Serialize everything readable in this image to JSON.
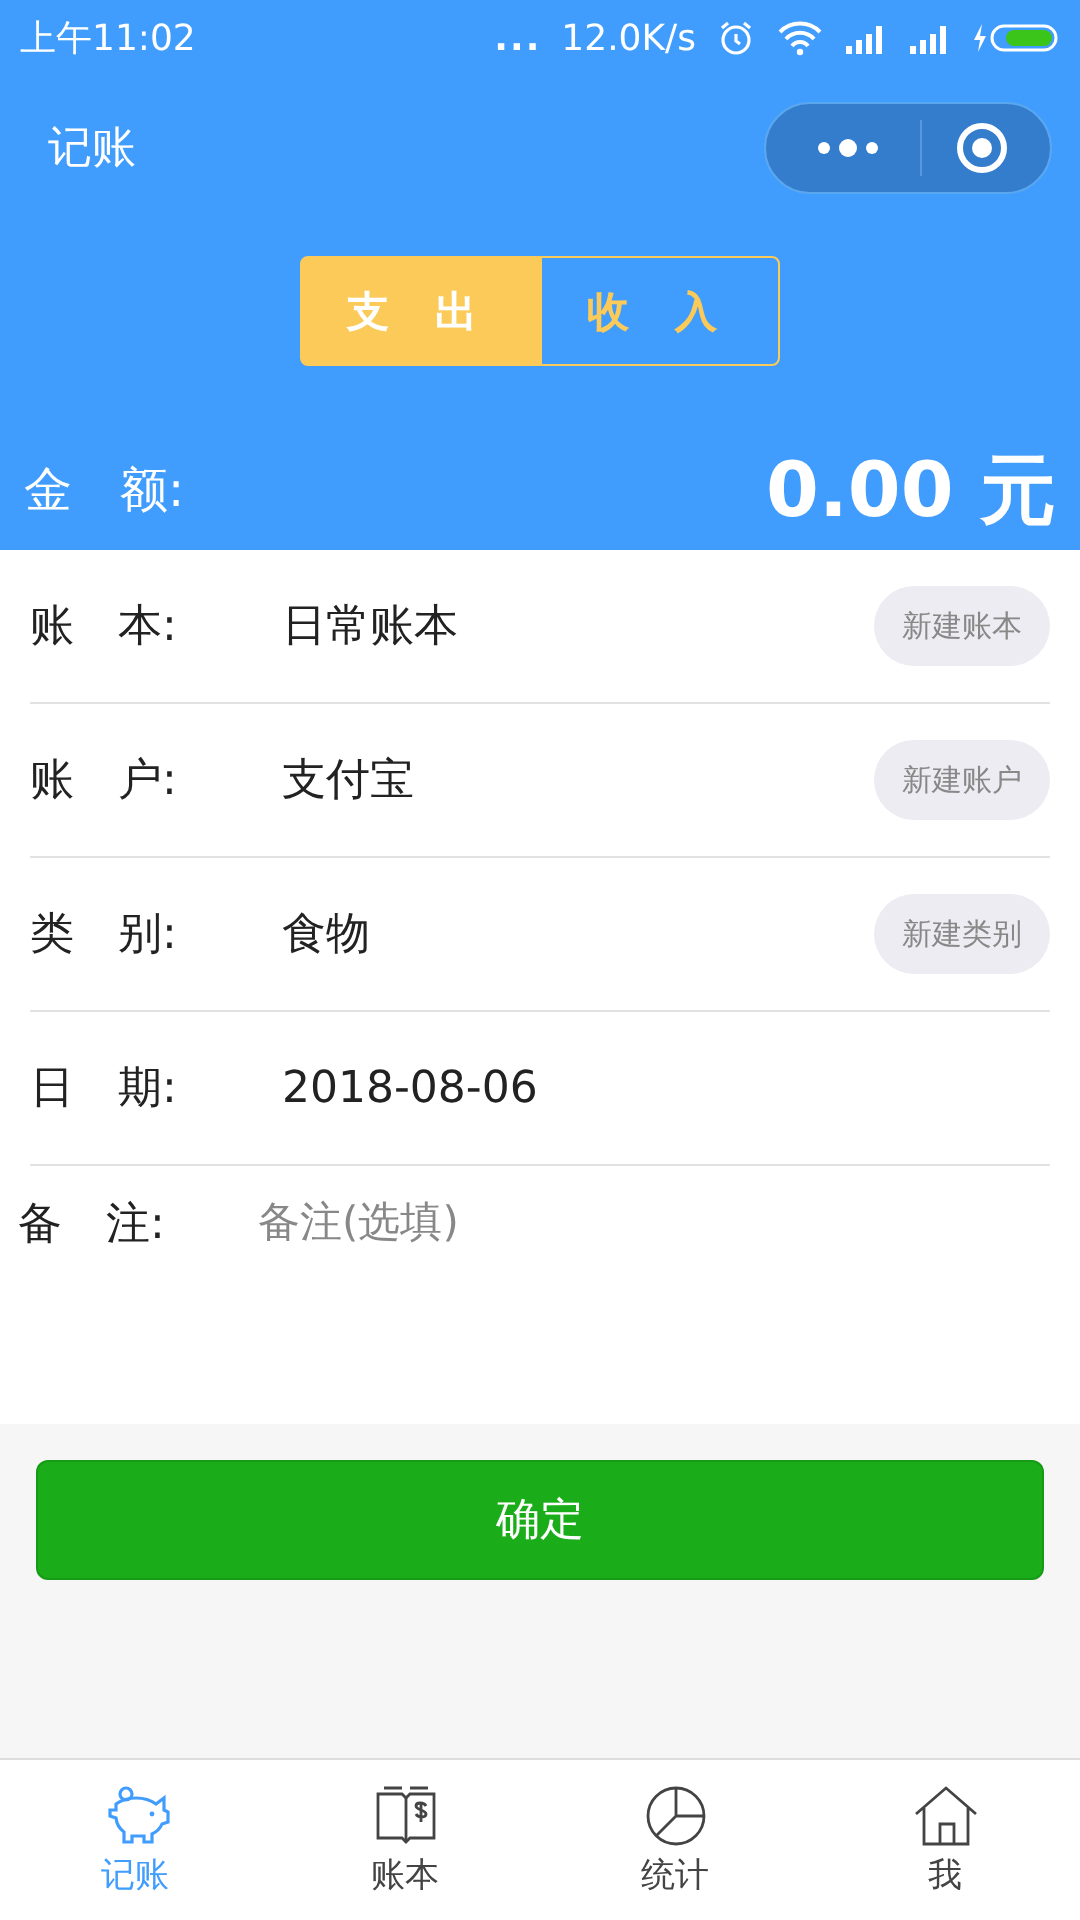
{
  "status_bar": {
    "time": "上午11:02",
    "more": "...",
    "speed": "12.0K/s"
  },
  "nav": {
    "title": "记账"
  },
  "type_tabs": [
    {
      "label": "支 出",
      "selected": true
    },
    {
      "label": "收 入",
      "selected": false
    }
  ],
  "amount": {
    "label": "金　额:",
    "value": "0.00 元"
  },
  "form_rows": [
    {
      "kind": "value",
      "label": "账　本:",
      "value": "日常账本",
      "action": "新建账本"
    },
    {
      "kind": "value",
      "label": "账　户:",
      "value": "支付宝",
      "action": "新建账户"
    },
    {
      "kind": "value",
      "label": "类　别:",
      "value": "食物",
      "action": "新建类别"
    },
    {
      "kind": "value",
      "label": "日　期:",
      "value": "2018-08-06"
    },
    {
      "kind": "note",
      "label": "备　注:",
      "placeholder": "备注(选填)"
    }
  ],
  "confirm_button": "确定",
  "tab_bar": [
    {
      "label": "记账",
      "kind": "piggy",
      "selected": true
    },
    {
      "label": "账本",
      "kind": "book",
      "selected": false
    },
    {
      "label": "统计",
      "kind": "pie",
      "selected": false
    },
    {
      "label": "我",
      "kind": "house",
      "selected": false
    }
  ]
}
